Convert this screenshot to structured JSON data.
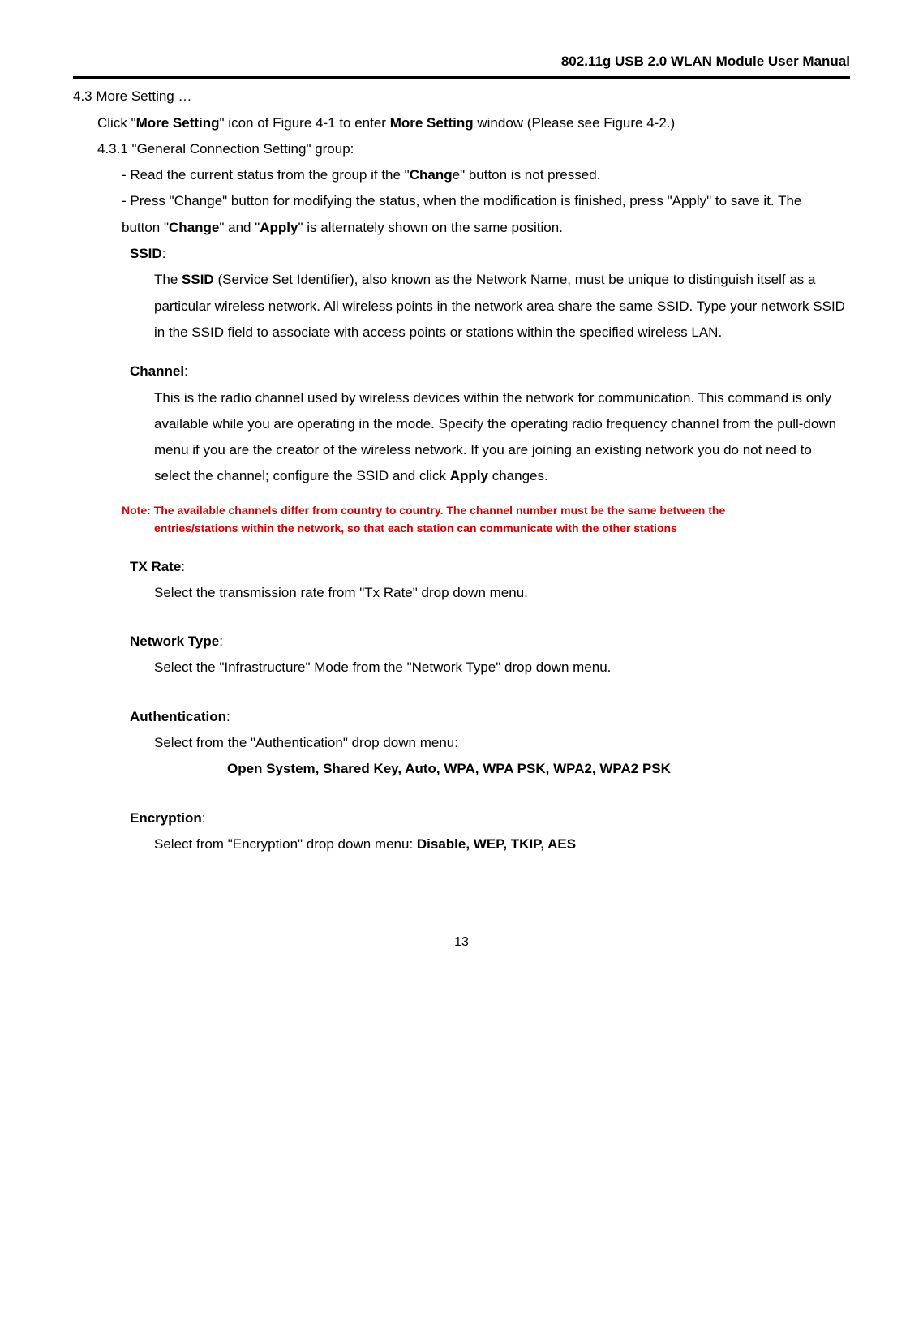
{
  "header": {
    "title": "802.11g USB 2.0 WLAN Module User Manual"
  },
  "s4_3": {
    "num": "4.3",
    "title": "More Setting …",
    "intro_a": "Click  \"",
    "intro_b": "More Setting",
    "intro_c": "\"  icon of Figure 4-1 to enter ",
    "intro_d": "More Setting",
    "intro_e": " window (Please see   Figure 4-2.)"
  },
  "s4_3_1": {
    "num": "4.3.1",
    "title": " \"General Connection Setting\"  group:",
    "bullet1_a": "-   Read the current status from the group if the  \"",
    "bullet1_b": "Chang",
    "bullet1_c": "e\"  button is not pressed.",
    "bullet2_a": "-   Press  \"Change\"  button for modifying the status, when the modification is finished, press \"Apply\"  to save it. The button  \"",
    "bullet2_b": "Change",
    "bullet2_c": "\"  and  \"",
    "bullet2_d": "Apply",
    "bullet2_e": "\"  is alternately shown on the same position."
  },
  "ssid": {
    "label": "SSID",
    "colon": ":",
    "body_a": "The ",
    "body_b": "SSID",
    "body_c": " (Service Set Identifier), also known as the Network Name, must be unique to distinguish itself as a particular wireless network. All wireless points in the network area share the same SSID. Type your network SSID in the SSID field to associate with access points or stations within the specified wireless LAN."
  },
  "channel": {
    "label": "Channel",
    "colon": ":",
    "body_a": "This is the radio channel used by wireless devices within the network for communication. This command is only available while you are operating in the mode. Specify the operating radio frequency channel from the pull-down menu if you are the creator of the wireless network. If you are joining an existing network you do not need to select the channel; configure the SSID and click ",
    "body_b": "Apply",
    "body_c": " changes."
  },
  "note": {
    "prefix": "Note: ",
    "body": "The available channels differ from country to country. The channel number must be the same between the entries/stations within the network, so that each station can communicate with the other stations"
  },
  "txrate": {
    "label": "TX Rate",
    "colon": ":",
    "body": "Select the transmission rate from  \"Tx Rate\"  drop down menu."
  },
  "nettype": {
    "label": "Network Type",
    "colon": ":",
    "body": "Select the \"Infrastructure\"  Mode from the  \"Network Type\"  drop down menu."
  },
  "auth": {
    "label": "Authentication",
    "colon": ":",
    "body": "Select from the  \"Authentication\"  drop down menu:",
    "options": "Open System, Shared Key, Auto, WPA, WPA PSK, WPA2, WPA2 PSK"
  },
  "enc": {
    "label": "Encryption",
    "colon": ":",
    "body_a": "Select from  \"Encryption\"  drop down menu: ",
    "body_b": "Disable, WEP, TKIP, AES"
  },
  "page_number": "13"
}
